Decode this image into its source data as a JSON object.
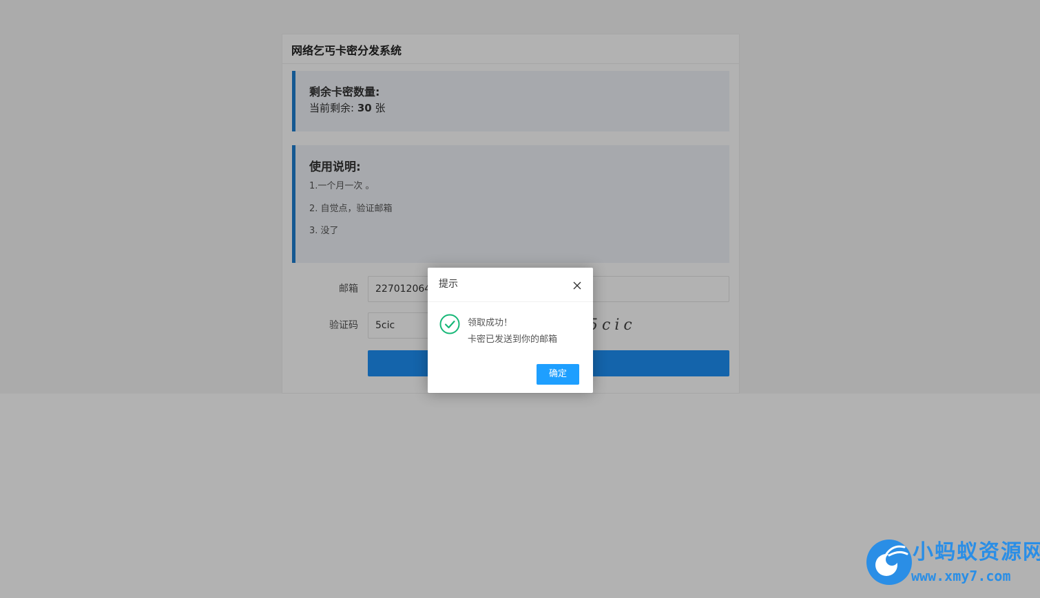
{
  "page": {
    "title": "网络乞丐卡密分发系统"
  },
  "remain": {
    "heading": "剩余卡密数量:",
    "prefix": "当前剩余:",
    "count": "30",
    "unit": "张"
  },
  "usage": {
    "heading": "使用说明:",
    "items": [
      "1.一个月一次 。",
      "2. 自觉点，验证邮箱",
      "3. 没了"
    ]
  },
  "form": {
    "email_label": "邮箱",
    "email_value": "2270120640",
    "captcha_label": "验证码",
    "captcha_value": "5cic",
    "captcha_image_text": "5cic"
  },
  "dialog": {
    "title": "提示",
    "message_line1": "领取成功！",
    "message_line2": "卡密已发送到你的邮箱",
    "ok_label": "确定"
  },
  "watermark": {
    "name": "小蚂蚁资源网",
    "url": "www.xmy7.com"
  },
  "colors": {
    "accent": "#1e7fd0",
    "button": "#1e90f5",
    "dialog_button": "#1e9fff",
    "success": "#16b777",
    "watermark": "#2a8ee6"
  },
  "icons": {
    "dialog_status": "check-circle-icon",
    "dialog_close": "close-icon"
  }
}
